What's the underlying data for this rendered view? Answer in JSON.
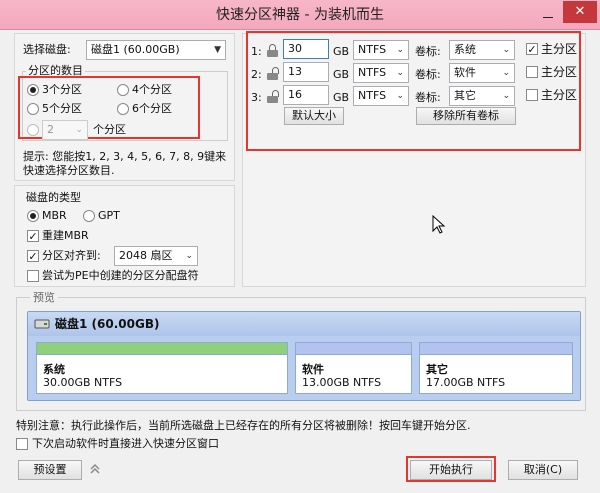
{
  "window": {
    "title": "快速分区神器 - 为装机而生",
    "close_glyph": "✕"
  },
  "disk_select": {
    "label": "选择磁盘:",
    "value": "磁盘1 (60.00GB)"
  },
  "partition_count": {
    "label": "分区的数目",
    "options": [
      "3个分区",
      "4个分区",
      "5个分区",
      "6个分区"
    ],
    "selected": "3个分区",
    "custom_value": "2",
    "custom_suffix": "个分区"
  },
  "hint": {
    "line1": "提示: 您能按1, 2, 3, 4, 5, 6, 7, 8, 9键来",
    "line2": "快速选择分区数目."
  },
  "disk_type": {
    "label": "磁盘的类型",
    "mbr": "MBR",
    "gpt": "GPT",
    "selected": "MBR",
    "rebuild_mbr": "重建MBR",
    "rebuild_checked": true,
    "align_label": "分区对齐到:",
    "align_checked": true,
    "align_value": "2048 扇区",
    "try_pe": "尝试为PE中创建的分区分配盘符",
    "try_pe_checked": false
  },
  "partitions": [
    {
      "index": "1:",
      "size": "30",
      "unit": "GB",
      "fs": "NTFS",
      "label_caption": "卷标:",
      "label": "系统",
      "primary": "主分区",
      "primary_checked": true,
      "locked": true
    },
    {
      "index": "2:",
      "size": "13",
      "unit": "GB",
      "fs": "NTFS",
      "label_caption": "卷标:",
      "label": "软件",
      "primary": "主分区",
      "primary_checked": false,
      "locked": false
    },
    {
      "index": "3:",
      "size": "16",
      "unit": "GB",
      "fs": "NTFS",
      "label_caption": "卷标:",
      "label": "其它",
      "primary": "主分区",
      "primary_checked": false,
      "locked": false
    }
  ],
  "buttons": {
    "default_size": "默认大小",
    "remove_labels": "移除所有卷标",
    "preset": "预设置",
    "start": "开始执行",
    "cancel": "取消(C)"
  },
  "preview": {
    "label": "预览",
    "disk_name": "磁盘1 (60.00GB)",
    "parts": [
      {
        "name": "系统",
        "size": "30.00GB NTFS",
        "color": "#8fd17a"
      },
      {
        "name": "软件",
        "size": "13.00GB NTFS",
        "color": "#b3c3f0"
      },
      {
        "name": "其它",
        "size": "17.00GB NTFS",
        "color": "#b3c3f0"
      }
    ]
  },
  "warning": "特别注意：执行此操作后，当前所选磁盘上已经存在的所有分区将被删除！按回车键开始分区.",
  "quick_enter": {
    "label": "下次启动软件时直接进入快速分区窗口",
    "checked": false
  },
  "colors": {
    "title_bg": "#f4a8bd",
    "close_bg": "#c4383b",
    "highlight": "#e8342f",
    "disk_bg": "#b9cdee"
  },
  "icons": {
    "lock": "lock-icon",
    "unlock": "unlock-icon",
    "disk": "disk-icon",
    "expand": "double-chevron-up-icon"
  }
}
